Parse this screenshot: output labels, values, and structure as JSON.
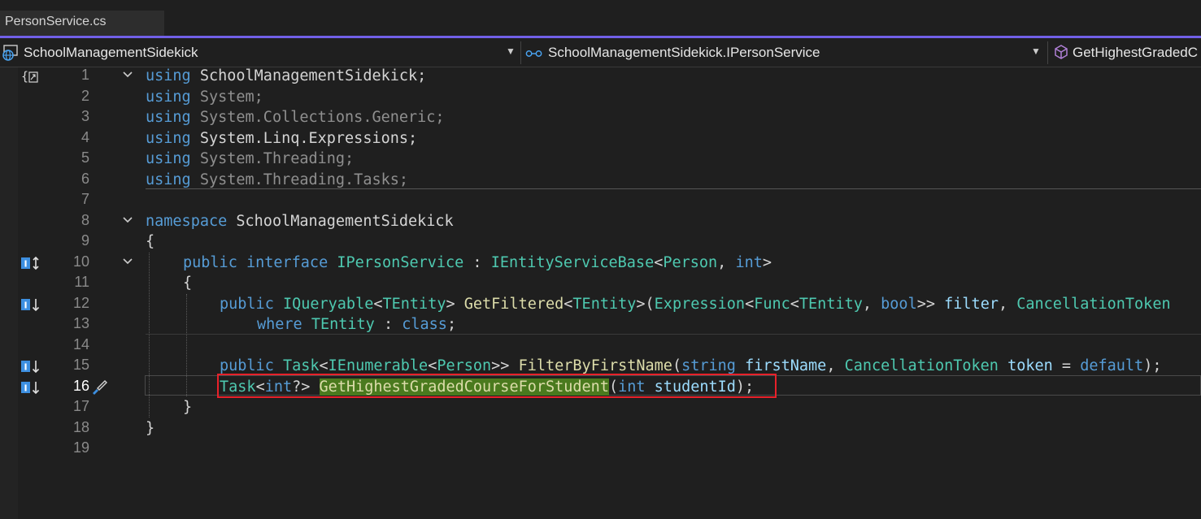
{
  "tab": {
    "file_name": "PersonService.cs"
  },
  "navbar": {
    "project": "SchoolManagementSidekick",
    "type": "SchoolManagementSidekick.IPersonService",
    "member": "GetHighestGradedC"
  },
  "colors": {
    "accent": "#7160e8",
    "keyword": "#569cd6",
    "type": "#4ec9b0",
    "method": "#dcdcaa",
    "parameter": "#9cdcfe",
    "highlight_box": "#e8212a",
    "match_highlight": "#4a7a1e"
  },
  "editor": {
    "current_line": "16",
    "lines": [
      {
        "num": "1",
        "t": [
          "using",
          " SchoolManagementSidekick;"
        ]
      },
      {
        "num": "2",
        "t": [
          "using",
          " System;"
        ]
      },
      {
        "num": "3",
        "t": [
          "using",
          " System.Collections.Generic;"
        ]
      },
      {
        "num": "4",
        "t": [
          "using",
          " System.Linq.Expressions;"
        ]
      },
      {
        "num": "5",
        "t": [
          "using",
          " System.Threading;"
        ]
      },
      {
        "num": "6",
        "t": [
          "using",
          " System.Threading.Tasks;"
        ]
      },
      {
        "num": "7",
        "t": []
      },
      {
        "num": "8",
        "t": [
          "namespace",
          " SchoolManagementSidekick"
        ]
      },
      {
        "num": "9",
        "t": [
          "{"
        ]
      },
      {
        "num": "10",
        "t": [
          "public",
          " ",
          "interface",
          " ",
          "IPersonService",
          " : ",
          "IEntityServiceBase",
          "<",
          "Person",
          ", ",
          "int",
          ">"
        ]
      },
      {
        "num": "11",
        "t": [
          "{"
        ]
      },
      {
        "num": "12",
        "t": [
          "public",
          " ",
          "IQueryable",
          "<",
          "TEntity",
          "> ",
          "GetFiltered",
          "<",
          "TEntity",
          ">(",
          "Expression",
          "<",
          "Func",
          "<",
          "TEntity",
          ", ",
          "bool",
          ">> ",
          "filter",
          ", ",
          "CancellationToken"
        ]
      },
      {
        "num": "13",
        "t": [
          "where",
          " ",
          "TEntity",
          " : ",
          "class",
          ";"
        ]
      },
      {
        "num": "14",
        "t": []
      },
      {
        "num": "15",
        "t": [
          "public",
          " ",
          "Task",
          "<",
          "IEnumerable",
          "<",
          "Person",
          ">> ",
          "FilterByFirstName",
          "(",
          "string",
          " ",
          "firstName",
          ", ",
          "CancellationToken",
          " ",
          "token",
          " = ",
          "default",
          ");"
        ]
      },
      {
        "num": "16",
        "t": [
          "Task",
          "<",
          "int",
          "?> ",
          "GetHighestGradedCourseForStudent",
          "(",
          "int",
          " ",
          "studentId",
          ");"
        ]
      },
      {
        "num": "17",
        "t": [
          "}"
        ]
      },
      {
        "num": "18",
        "t": [
          "}"
        ]
      },
      {
        "num": "19",
        "t": []
      }
    ]
  }
}
